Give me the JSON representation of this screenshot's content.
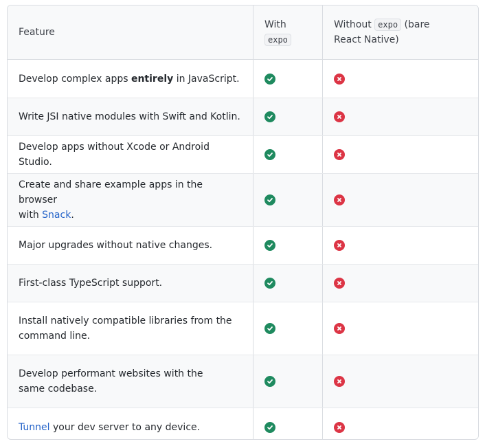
{
  "header": {
    "feature": "Feature",
    "with_prefix": "With",
    "with_code": "expo",
    "without_prefix": "Without",
    "without_code": "expo",
    "without_suffix": "(bare",
    "without_line2": "React Native)"
  },
  "rows": [
    {
      "parts": [
        "Develop complex apps ",
        "entirely",
        " in JavaScript."
      ]
    },
    {
      "text": "Write JSI native modules with Swift and Kotlin."
    },
    {
      "text": "Develop apps without Xcode or Android Studio."
    },
    {
      "line1": "Create and share example apps in the browser",
      "line2_prefix": "with ",
      "link": "Snack",
      "line2_suffix": "."
    },
    {
      "text": "Major upgrades without native changes."
    },
    {
      "text": "First-class TypeScript support."
    },
    {
      "line1": "Install natively compatible libraries from the",
      "line2": "command line."
    },
    {
      "line1": "Develop performant websites with the",
      "line2": "same codebase."
    },
    {
      "link": "Tunnel",
      "suffix": " your dev server to any device."
    }
  ],
  "icons": {
    "with": "check-circle-icon",
    "without": "x-circle-icon",
    "with_color": "#1f8a5f",
    "without_color": "#dc3545"
  }
}
